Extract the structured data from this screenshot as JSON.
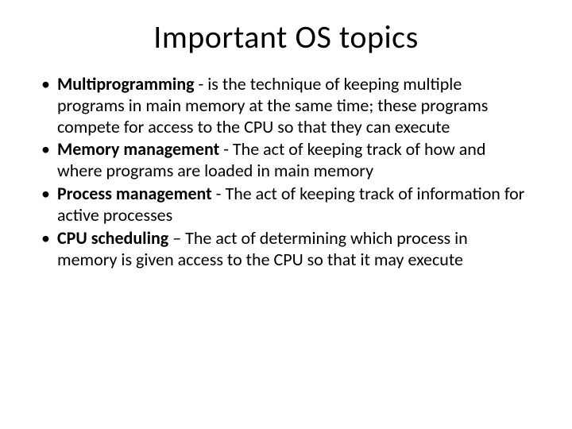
{
  "slide": {
    "title": "Important OS topics",
    "bullets": [
      {
        "term": "Multiprogramming",
        "sep": " -  ",
        "desc": "is the technique of keeping multiple programs in main memory at the same time; these programs compete for access to the CPU so that they can execute"
      },
      {
        "term": "Memory management",
        "sep": " - ",
        "desc": "The act of keeping track of how and where programs are loaded in main memory"
      },
      {
        "term": "Process management",
        "sep": " - ",
        "desc": "The act of keeping track of information for active processes"
      },
      {
        "term": "CPU scheduling",
        "sep": " – ",
        "desc": "The act of determining which process in memory is given access to the CPU so that it may execute"
      }
    ]
  }
}
